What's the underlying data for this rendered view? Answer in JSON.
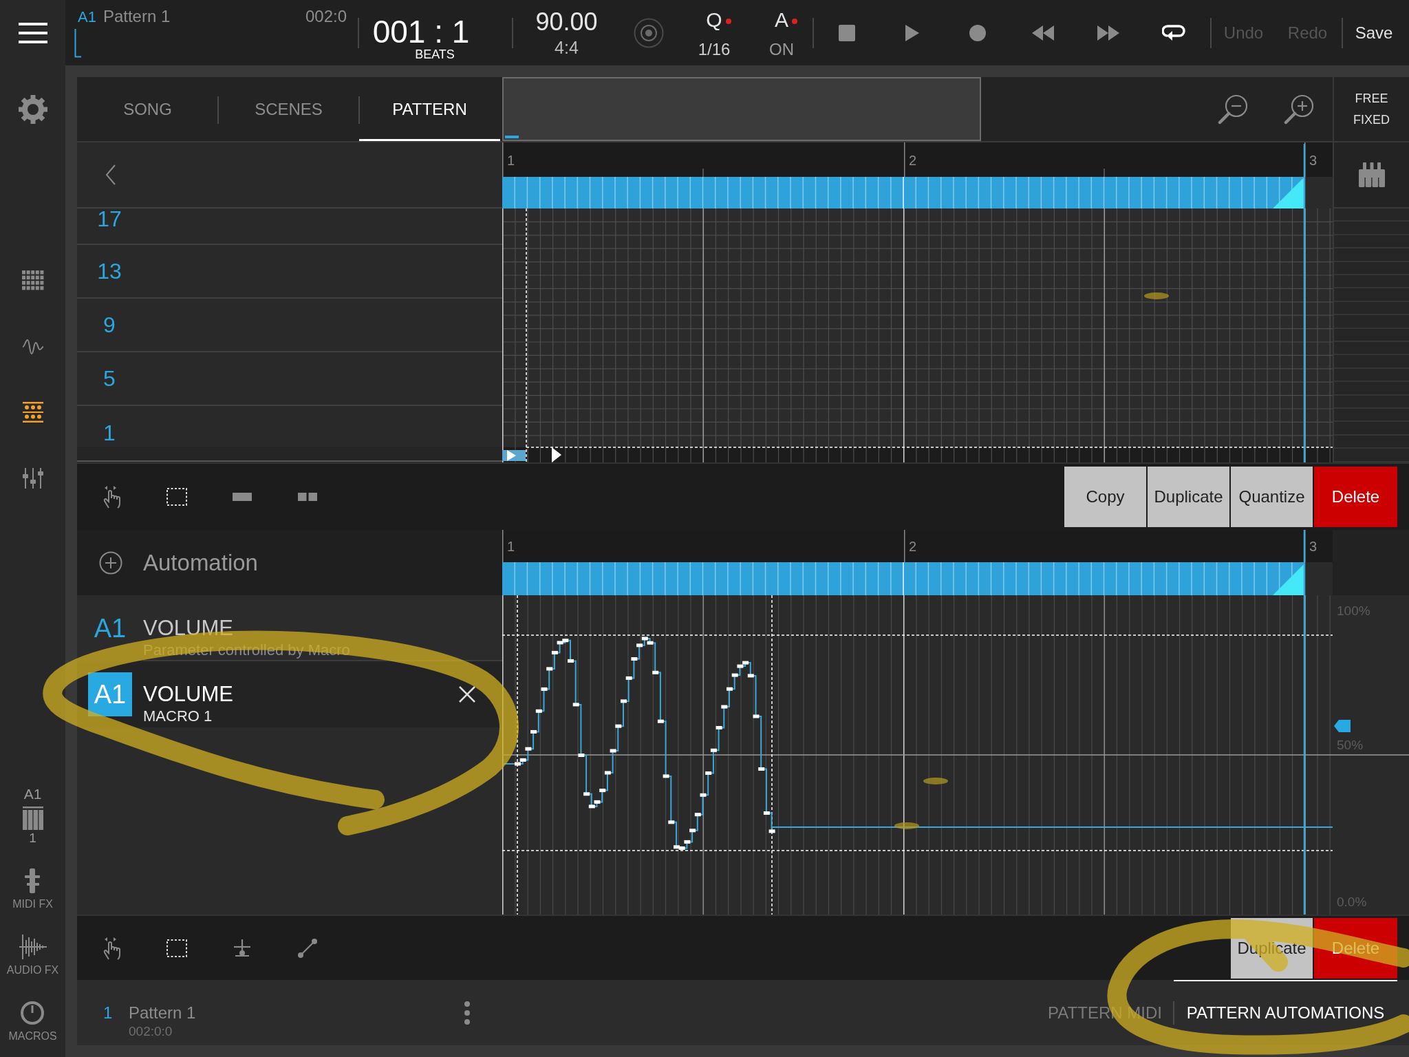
{
  "top_bar": {
    "track": "A1",
    "pattern": "Pattern 1",
    "pattern_position": "002:0",
    "position": "001 : 1",
    "position_unit": "BEATS",
    "tempo": "90.00",
    "time_signature": "4:4",
    "quantize": {
      "label": "Q",
      "value": "1/16",
      "on": true
    },
    "auto": {
      "label": "A",
      "value": "ON",
      "on": true
    },
    "loop_on": true,
    "actions": [
      {
        "label": "Undo",
        "disabled": true
      },
      {
        "label": "Redo",
        "disabled": true
      },
      {
        "label": "Save",
        "disabled": false
      }
    ]
  },
  "sidebar": {
    "nav": [
      {
        "kind": "grid",
        "selected": false
      },
      {
        "kind": "wave",
        "selected": false
      },
      {
        "kind": "sequencer",
        "selected": true
      },
      {
        "kind": "mixer",
        "selected": false
      }
    ],
    "track": {
      "name": "A1",
      "number": "1"
    },
    "modules": [
      {
        "kind": "midi_fx",
        "label": "MIDI FX"
      },
      {
        "kind": "audio_fx",
        "label": "AUDIO FX"
      },
      {
        "kind": "macros",
        "label": "MACROS"
      }
    ]
  },
  "tabs": [
    {
      "label": "SONG",
      "selected": false
    },
    {
      "label": "SCENES",
      "selected": false
    },
    {
      "label": "PATTERN",
      "selected": true
    }
  ],
  "snap_modes": [
    "FREE",
    "FIXED"
  ],
  "piano_roll": {
    "ruler": [
      "1",
      "2",
      "3"
    ],
    "rows": [
      "17",
      "13",
      "9",
      "5",
      "1"
    ],
    "buttons": [
      {
        "label": "Copy",
        "kind": "copy"
      },
      {
        "label": "Duplicate",
        "kind": "duplicate"
      },
      {
        "label": "Quantize",
        "kind": "quantize"
      },
      {
        "label": "Delete",
        "kind": "delete"
      }
    ]
  },
  "automation": {
    "header": "Automation",
    "lanes": [
      {
        "track": "A1",
        "parameter": "VOLUME",
        "detail": "Parameter controlled by Macro",
        "selected": false
      },
      {
        "track": "A1",
        "parameter": "VOLUME",
        "detail": "MACRO 1",
        "selected": true
      }
    ],
    "ruler": [
      "1",
      "2",
      "3"
    ],
    "scale": [
      "100%",
      "50%",
      "0.0%"
    ],
    "buttons": [
      {
        "label": "Duplicate",
        "kind": "duplicate"
      },
      {
        "label": "Delete",
        "kind": "delete"
      }
    ]
  },
  "footer": {
    "number": "1",
    "name": "Pattern 1",
    "position": "002:0:0",
    "tabs": [
      {
        "label": "PATTERN MIDI",
        "selected": false
      },
      {
        "label": "PATTERN AUTOMATIONS",
        "selected": true
      }
    ]
  }
}
